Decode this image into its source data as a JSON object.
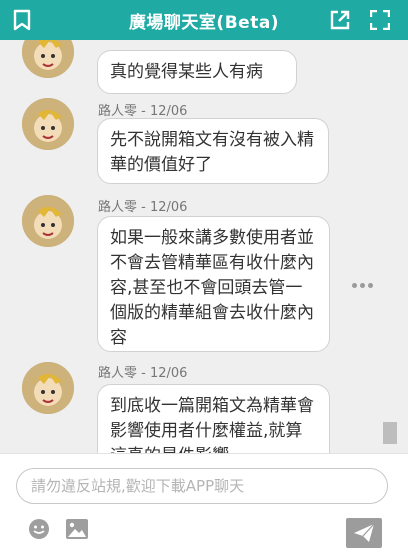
{
  "header": {
    "title": "廣場聊天室(Beta)",
    "left_icon": "bookmark-icon",
    "right_icons": [
      "open-external-icon",
      "fullscreen-icon"
    ]
  },
  "messages": [
    {
      "author": "",
      "time": "",
      "text": "真的覺得某些人有病",
      "avatar_icon": "avatar"
    },
    {
      "author": "路人零",
      "time": "12/06",
      "text": "先不說開箱文有沒有被入精華的價值好了",
      "avatar_icon": "avatar"
    },
    {
      "author": "路人零",
      "time": "12/06",
      "text": "如果一般來講多數使用者並不會去管精華區有收什麼內容,甚至也不會回頭去管一個版的精華組會去收什麼內容",
      "avatar_icon": "avatar"
    },
    {
      "author": "路人零",
      "time": "12/06",
      "text": "到底收一篇開箱文為精華會影響使用者什麼權益,就算這真的是件影響",
      "avatar_icon": "avatar"
    }
  ],
  "composer": {
    "placeholder": "請勿違反站規,歡迎下載APP聊天",
    "emoji_icon": "emoji-icon",
    "image_icon": "image-icon",
    "send_icon": "send-icon"
  },
  "colors": {
    "header": "#1faaa4",
    "send_button": "#9c9c9c"
  }
}
